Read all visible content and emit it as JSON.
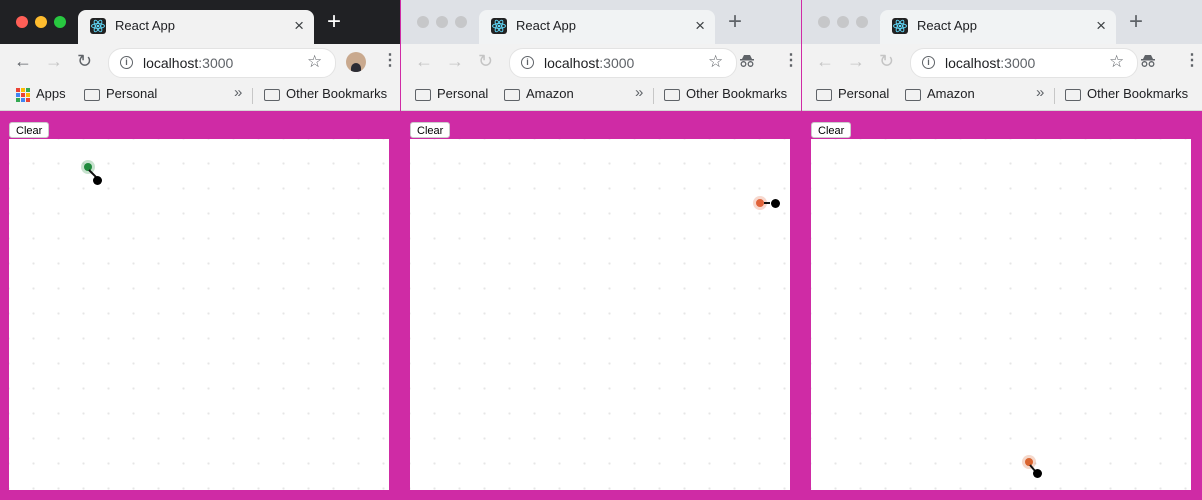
{
  "windows": [
    {
      "state": "active",
      "tab_title": "React App",
      "url_host": "localhost",
      "url_port": ":3000",
      "bookmarks": [
        "Apps",
        "Personal"
      ],
      "other_bookmarks": "Other Bookmarks",
      "more_bookmarks": "»",
      "clear_label": "Clear",
      "pen_color": "#1f8a3c"
    },
    {
      "state": "inactive",
      "tab_title": "React App",
      "url_host": "localhost",
      "url_port": ":3000",
      "bookmarks": [
        "Personal",
        "Amazon"
      ],
      "other_bookmarks": "Other Bookmarks",
      "more_bookmarks": "»",
      "clear_label": "Clear",
      "pen_color": "#e0633a"
    },
    {
      "state": "inactive",
      "tab_title": "React App",
      "url_host": "localhost",
      "url_port": ":3000",
      "bookmarks": [
        "Personal",
        "Amazon"
      ],
      "other_bookmarks": "Other Bookmarks",
      "more_bookmarks": "»",
      "clear_label": "Clear",
      "pen_color": "#d9642f"
    }
  ],
  "icons": {
    "close": "×",
    "new_tab": "+",
    "back": "←",
    "forward": "→",
    "reload": "↻",
    "star": "☆",
    "info": "i",
    "menu": "⋮"
  },
  "colors": {
    "page_background": "#cf2ba5",
    "canvas_background": "#ffffff"
  }
}
